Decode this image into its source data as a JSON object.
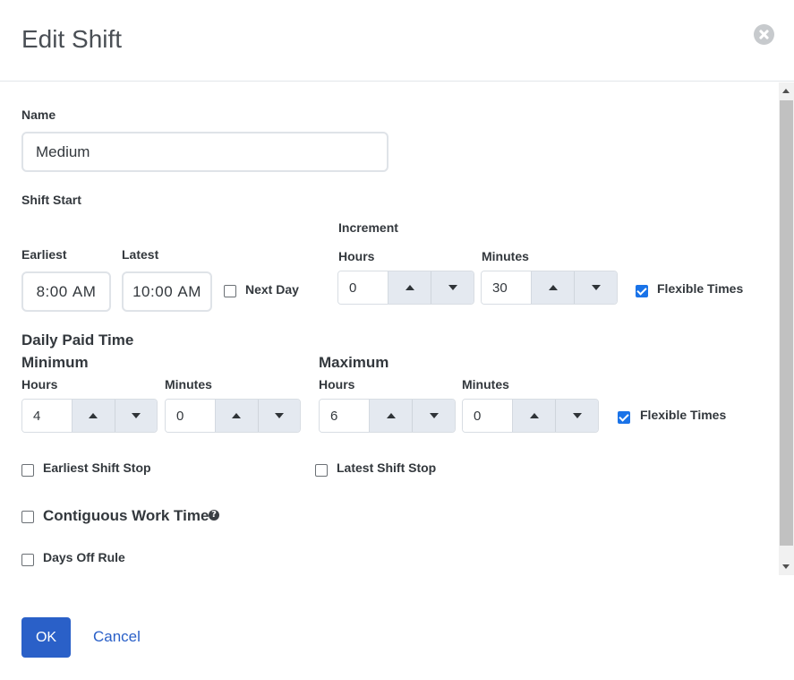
{
  "dialog": {
    "title": "Edit Shift"
  },
  "name": {
    "label": "Name",
    "value": "Medium"
  },
  "shift_start": {
    "label": "Shift Start",
    "earliest_label": "Earliest",
    "earliest_hour": "8",
    "earliest_minute": "00",
    "earliest_ampm": "AM",
    "latest_label": "Latest",
    "latest_hour": "10",
    "latest_minute": "00",
    "latest_ampm": "AM",
    "next_day_label": "Next Day",
    "next_day_checked": false
  },
  "increment": {
    "label": "Increment",
    "hours_label": "Hours",
    "hours_value": "0",
    "minutes_label": "Minutes",
    "minutes_value": "30",
    "flexible_label": "Flexible Times",
    "flexible_checked": true
  },
  "daily_paid_time": {
    "label": "Daily Paid Time",
    "minimum": {
      "label": "Minimum",
      "hours_label": "Hours",
      "hours_value": "4",
      "minutes_label": "Minutes",
      "minutes_value": "0"
    },
    "maximum": {
      "label": "Maximum",
      "hours_label": "Hours",
      "hours_value": "6",
      "minutes_label": "Minutes",
      "minutes_value": "0"
    },
    "flexible_label": "Flexible Times",
    "flexible_checked": true
  },
  "options": {
    "earliest_shift_stop": "Earliest Shift Stop",
    "latest_shift_stop": "Latest Shift Stop",
    "contiguous_work_time": "Contiguous Work Time",
    "days_off_rule": "Days Off Rule"
  },
  "icons": {
    "close": "close-circle-icon",
    "help": "question-circle-icon"
  },
  "colors": {
    "primary": "#2a60c8",
    "checkbox_checked": "#1a73e8",
    "spinner_button_bg": "#e4e9f0"
  },
  "footer": {
    "ok_label": "OK",
    "cancel_label": "Cancel"
  }
}
